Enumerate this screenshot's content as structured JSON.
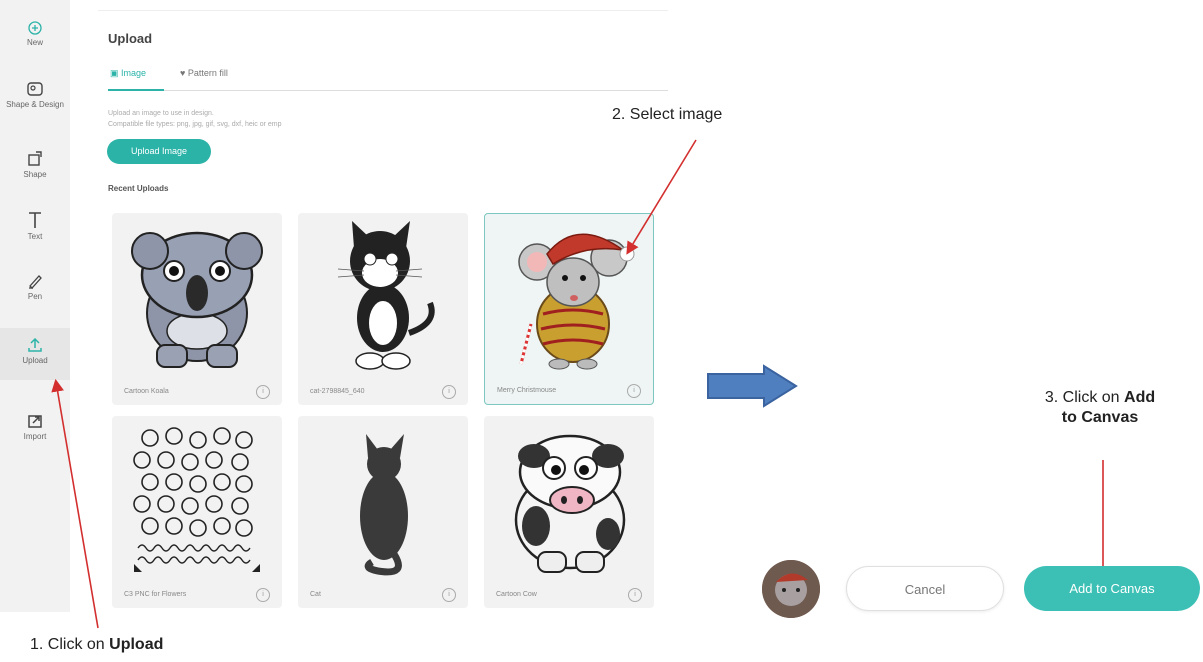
{
  "sidebar": {
    "items": [
      {
        "label": "New"
      },
      {
        "label": "Shape & Design"
      },
      {
        "label": "Shape"
      },
      {
        "label": "Text"
      },
      {
        "label": "Pen"
      },
      {
        "label": "Upload"
      },
      {
        "label": "Import"
      }
    ]
  },
  "panel": {
    "title": "Upload",
    "tabs": [
      {
        "label": "Image"
      },
      {
        "label": "Pattern fill"
      }
    ],
    "hint_line1": "Upload an image to use in design.",
    "hint_line2": "Compatible file types: png, jpg, gif, svg, dxf, heic or emp",
    "upload_button": "Upload Image",
    "recent_heading": "Recent Uploads",
    "cards": [
      {
        "label": "Cartoon Koala"
      },
      {
        "label": "cat-2798845_640"
      },
      {
        "label": "Merry Christmouse"
      },
      {
        "label": "C3 PNC for Flowers"
      },
      {
        "label": "Cat"
      },
      {
        "label": "Cartoon Cow"
      }
    ]
  },
  "actions": {
    "cancel_label": "Cancel",
    "add_label": "Add to Canvas"
  },
  "annotations": {
    "step1_prefix": "1. Click on ",
    "step1_bold": "Upload",
    "step2": "2. Select image",
    "step3_prefix": "3. Click on ",
    "step3_bold_a": "Add",
    "step3_bold_b": "to Canvas"
  },
  "colors": {
    "accent": "#2bb3a8",
    "annotation_arrow": "#d32f2f",
    "big_arrow": "#4f7fbf"
  }
}
